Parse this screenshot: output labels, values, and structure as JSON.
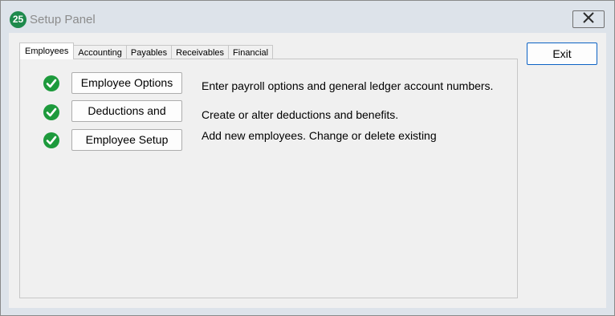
{
  "window": {
    "app_icon_text": "25",
    "title": "Setup Panel"
  },
  "tabs": [
    {
      "label": "Employees",
      "active": true
    },
    {
      "label": "Accounting",
      "active": false
    },
    {
      "label": "Payables",
      "active": false
    },
    {
      "label": "Receivables",
      "active": false
    },
    {
      "label": "Financial",
      "active": false
    }
  ],
  "rows": [
    {
      "button": "Employee Options",
      "description": "Enter payroll options and general ledger account numbers.",
      "status_icon": "check-circle-icon"
    },
    {
      "button": "Deductions and",
      "description": "Create or alter deductions and benefits.",
      "status_icon": "check-circle-icon"
    },
    {
      "button": "Employee Setup",
      "description": "Add new employees. Change or delete existing",
      "status_icon": "check-circle-icon"
    }
  ],
  "exit_label": "Exit",
  "colors": {
    "check_green": "#1d9a3c",
    "app_icon_green": "#1e8a4c",
    "focus_blue": "#0c62c4"
  }
}
